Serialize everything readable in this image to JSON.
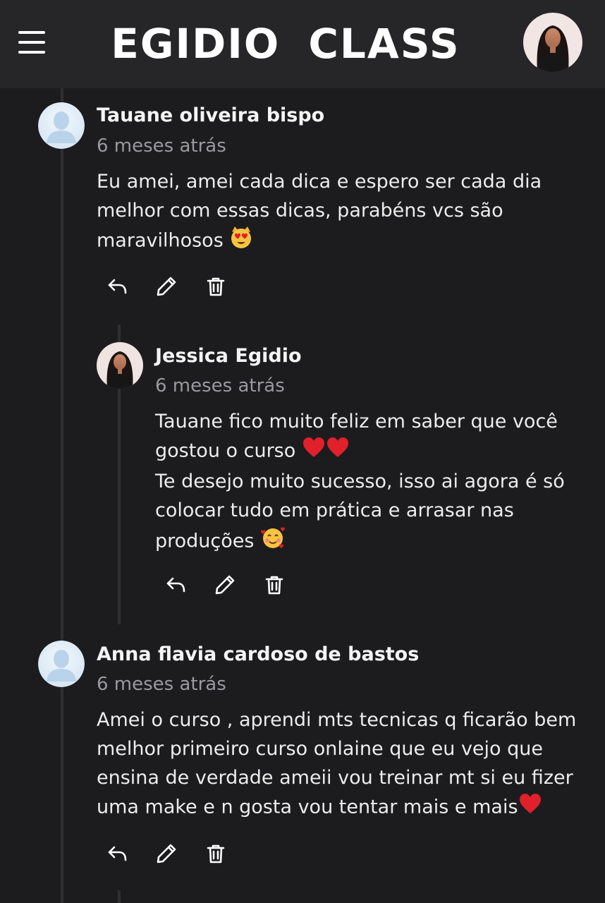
{
  "header": {
    "menu_icon": "hamburger-menu-icon",
    "brand": "EGIDIO  CLASS",
    "avatar_icon": "user-profile-avatar"
  },
  "comments": [
    {
      "author": "Tauane oliveira bispo",
      "time": "6 meses atrás",
      "lines": [
        "Eu amei, amei cada dica e espero ser cada dia",
        "melhor com essas dicas, parabéns vcs são",
        "maravilhosos"
      ],
      "emoji": "😻",
      "avatar": "default-user-avatar",
      "replies": [
        {
          "author": "Jessica Egidio",
          "time": "6 meses atrás",
          "lines": [
            "Tauane fico muito feliz em saber que você",
            "gostou o curso",
            "Te desejo muito sucesso, isso ai agora é só",
            "colocar tudo em prática e arrasar nas",
            "produções"
          ],
          "emojis": [
            "❤️",
            "❤️",
            "🥰"
          ],
          "avatar": "instructor-photo-avatar"
        }
      ]
    },
    {
      "author": "Anna flavia cardoso de bastos",
      "time": "6 meses atrás",
      "lines": [
        "Amei o curso , aprendi mts tecnicas q ficarão bem",
        "melhor primeiro curso onlaine que eu vejo que",
        "ensina de verdade ameii vou treinar mt si eu fizer",
        "uma make e n gosta vou tentar mais e mais"
      ],
      "emoji": "❤️",
      "avatar": "default-user-avatar"
    }
  ],
  "action_icons": [
    "reply-icon",
    "edit-icon",
    "delete-icon"
  ],
  "colors": {
    "background": "#1c1c1e",
    "topbar": "#262628",
    "text": "#f2f2f2",
    "muted": "#9a9a9e",
    "heart": "#e0202a"
  }
}
